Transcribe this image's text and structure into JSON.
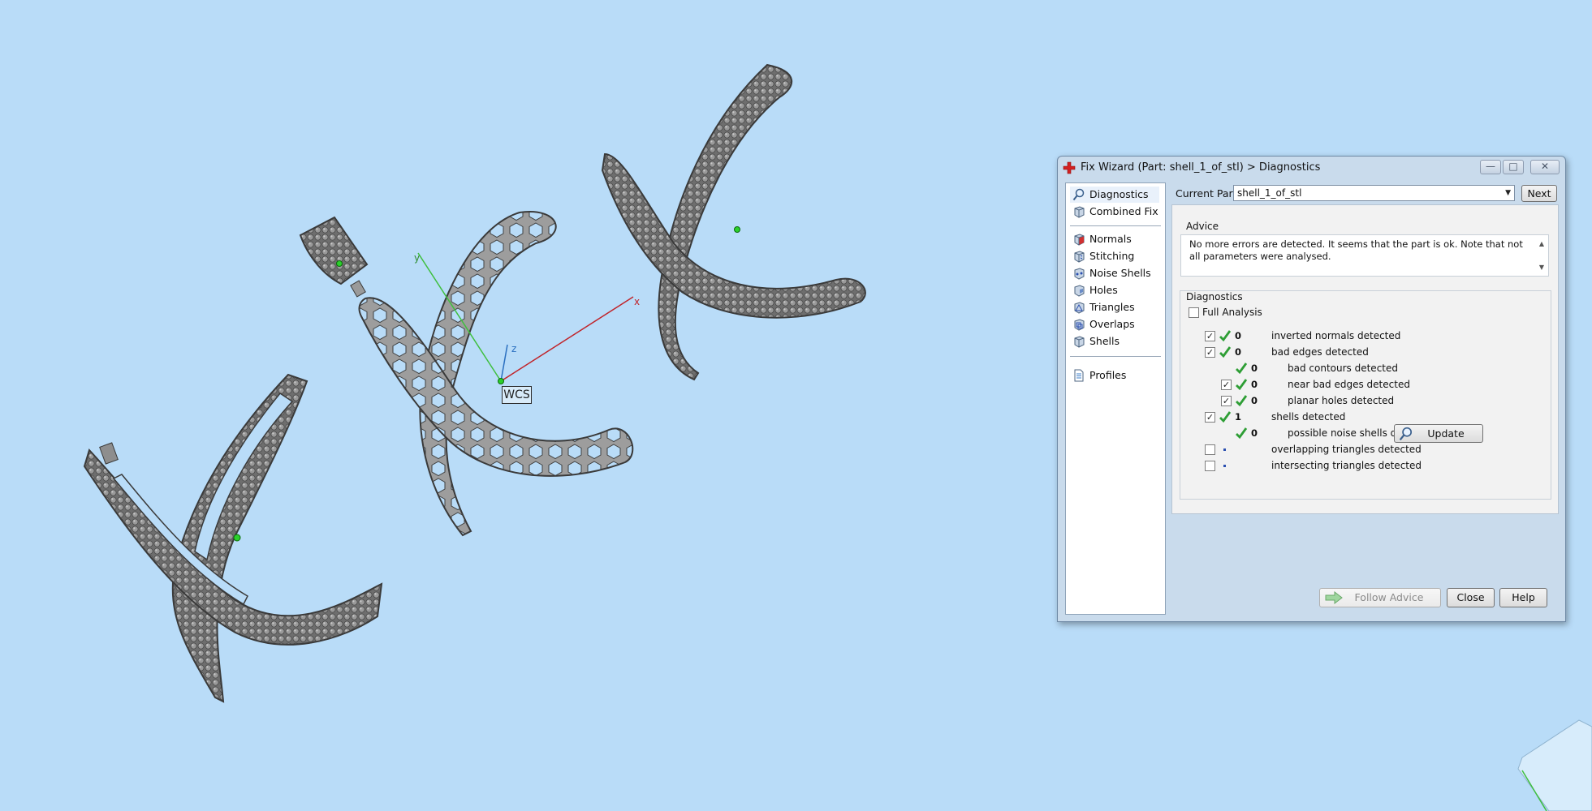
{
  "viewport": {
    "wcs_label": "WCS",
    "axis_x": "x",
    "axis_y": "y",
    "axis_z": "z"
  },
  "dialog": {
    "title": "Fix Wizard (Part: shell_1_of_stl) > Diagnostics",
    "window_buttons": {
      "minimize": "—",
      "maximize": "□",
      "close": "✕"
    },
    "sidebar": {
      "items": [
        {
          "label": "Diagnostics",
          "icon": "magnifier-icon"
        },
        {
          "label": "Combined Fix",
          "icon": "cube-icon"
        },
        {
          "label": "Normals",
          "icon": "cube-red-face-icon"
        },
        {
          "label": "Stitching",
          "icon": "cube-stitch-icon"
        },
        {
          "label": "Noise Shells",
          "icon": "cube-noise-icon"
        },
        {
          "label": "Holes",
          "icon": "cube-hole-icon"
        },
        {
          "label": "Triangles",
          "icon": "cube-triangle-icon"
        },
        {
          "label": "Overlaps",
          "icon": "cube-overlap-icon"
        },
        {
          "label": "Shells",
          "icon": "cube-shell-icon"
        },
        {
          "label": "Profiles",
          "icon": "document-icon"
        }
      ]
    },
    "current_part_label": "Current Part:",
    "current_part_value": "shell_1_of_stl",
    "next_button": "Next",
    "advice": {
      "title": "Advice",
      "text": "No more errors are detected. It seems that the part is ok. Note that not all parameters were analysed."
    },
    "diagnostics": {
      "title": "Diagnostics",
      "full_analysis_label": "Full Analysis",
      "full_analysis_checked": false,
      "rows": [
        {
          "checkbox": "checked",
          "status": "ok",
          "count": "0",
          "label": "inverted normals detected",
          "indent": 0
        },
        {
          "checkbox": "checked",
          "status": "ok",
          "count": "0",
          "label": "bad edges detected",
          "indent": 0
        },
        {
          "checkbox": "none",
          "status": "ok",
          "count": "0",
          "label": "bad contours detected",
          "indent": 1
        },
        {
          "checkbox": "checked",
          "status": "ok",
          "count": "0",
          "label": "near bad edges detected",
          "indent": 1
        },
        {
          "checkbox": "checked",
          "status": "ok",
          "count": "0",
          "label": "planar holes detected",
          "indent": 1
        },
        {
          "checkbox": "checked",
          "status": "ok",
          "count": "1",
          "label": "shells detected",
          "indent": 0
        },
        {
          "checkbox": "none",
          "status": "ok",
          "count": "0",
          "label": "possible noise shells detected",
          "indent": 1
        },
        {
          "checkbox": "unchecked",
          "status": "pending",
          "count": "",
          "label": "overlapping triangles detected",
          "indent": 0
        },
        {
          "checkbox": "unchecked",
          "status": "pending",
          "count": "",
          "label": "intersecting triangles detected",
          "indent": 0
        }
      ],
      "update_button": "Update"
    },
    "footer": {
      "follow_advice": "Follow Advice",
      "close": "Close",
      "help": "Help"
    }
  },
  "colors": {
    "background": "#b9dcf8",
    "part_fill": "#8e8e8e",
    "tick_green": "#2e9e35"
  }
}
